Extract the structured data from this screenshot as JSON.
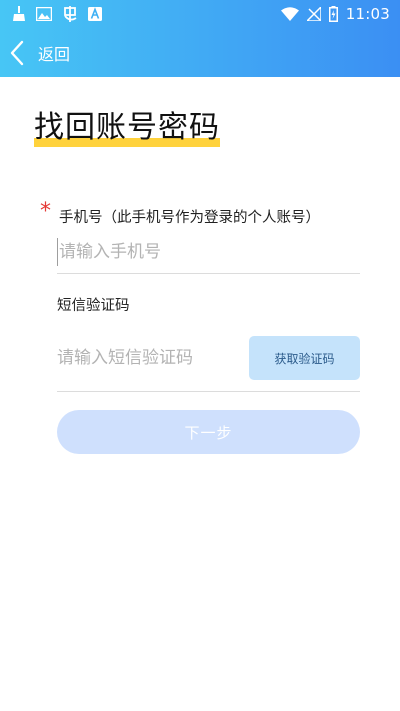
{
  "status_bar": {
    "time": "11:03",
    "left_icons": [
      "cleaner-icon",
      "image-icon",
      "bug-icon",
      "text-a-icon"
    ],
    "right_icons": [
      "wifi-icon",
      "no-signal-icon",
      "battery-charging-icon"
    ]
  },
  "nav": {
    "back_label": "返回"
  },
  "page": {
    "title": "找回账号密码"
  },
  "form": {
    "required_mark": "*",
    "phone_label": "手机号（此手机号作为登录的个人账号）",
    "phone_placeholder": "请输入手机号",
    "sms_label": "短信验证码",
    "sms_placeholder": "请输入短信验证码",
    "get_code_label": "获取验证码",
    "next_label": "下一步"
  },
  "colors": {
    "header_gradient_start": "#47c6f5",
    "header_gradient_end": "#3b8ff3",
    "title_highlight": "#ffd23c",
    "required": "#e53935",
    "code_button_bg": "#c5e3fb",
    "next_button_bg": "#cfe0fd"
  }
}
